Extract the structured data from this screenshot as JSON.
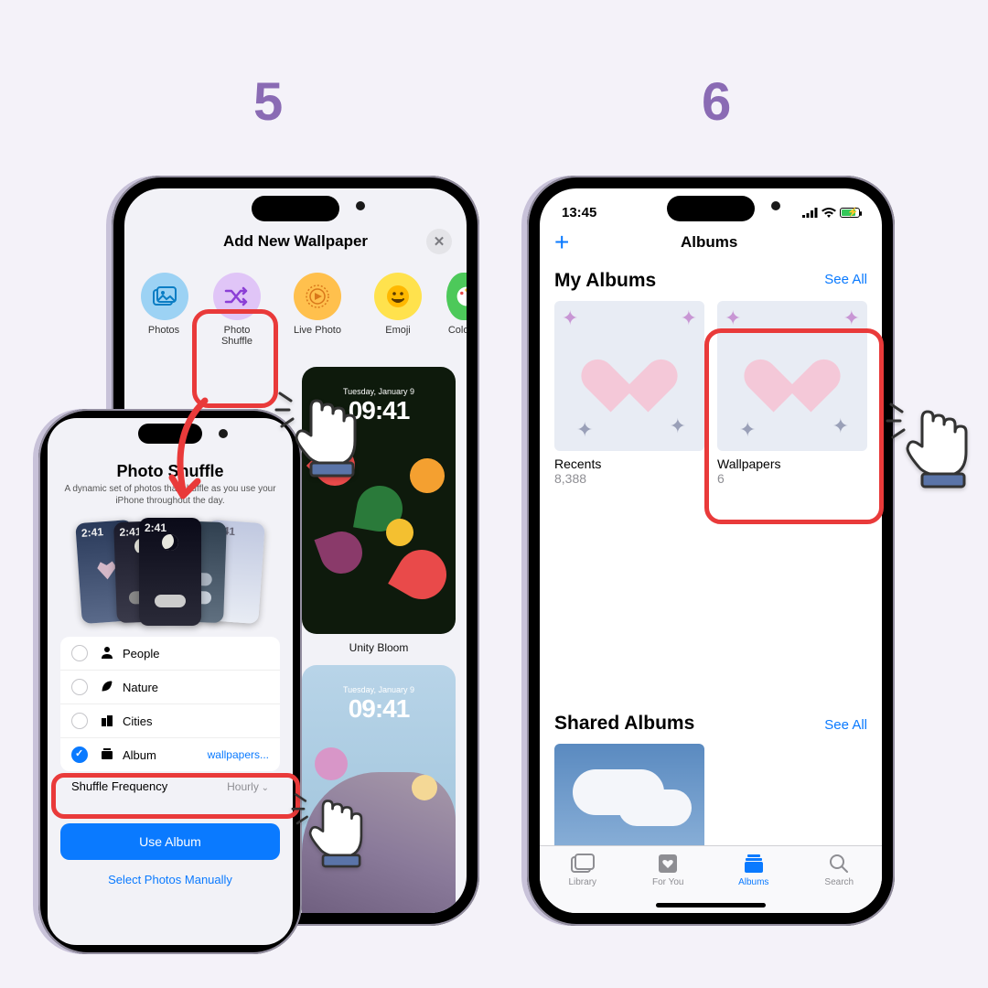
{
  "steps": {
    "left": "5",
    "right": "6"
  },
  "phoneA": {
    "title": "Add New Wallpaper",
    "categories": [
      {
        "label": "Photos"
      },
      {
        "label": "Photo\nShuffle"
      },
      {
        "label": "Live Photo"
      },
      {
        "label": "Emoji"
      },
      {
        "label": "Color"
      }
    ],
    "wallpaper1_date": "Tuesday, January 9",
    "wallpaper1_time": "09:41",
    "wallpaper1_name": "Unity Bloom",
    "wallpaper2_date": "Tuesday, January 9",
    "wallpaper2_time": "09:41"
  },
  "phoneB": {
    "title": "Photo Shuffle",
    "subtitle": "A dynamic set of photos that shuffle as you use your iPhone throughout the day.",
    "thumb_time": "2:41",
    "options": {
      "people": "People",
      "nature": "Nature",
      "cities": "Cities",
      "album": "Album",
      "album_value": "wallpapers..."
    },
    "freq_label": "Shuffle Frequency",
    "freq_value": "Hourly",
    "primary_btn": "Use Album",
    "secondary_btn": "Select Photos Manually"
  },
  "phoneC": {
    "time": "13:45",
    "nav_title": "Albums",
    "section1": "My Albums",
    "see_all": "See All",
    "albums": [
      {
        "name": "Recents",
        "count": "8,388"
      },
      {
        "name": "Wallpapers",
        "count": "6"
      }
    ],
    "section2": "Shared Albums",
    "tabs": {
      "library": "Library",
      "foryou": "For You",
      "albums": "Albums",
      "search": "Search"
    }
  }
}
